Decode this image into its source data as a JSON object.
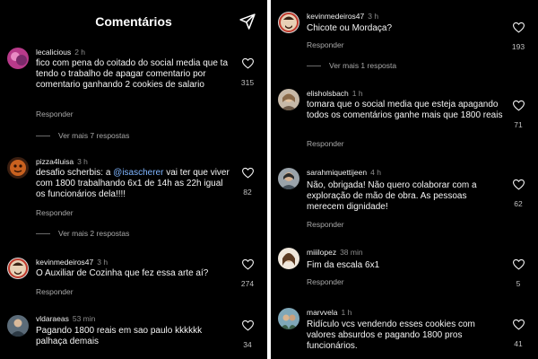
{
  "left": {
    "title": "Comentários",
    "comments": [
      {
        "user": "lecalicious",
        "time": "2 h",
        "text": "fico com pena do coitado do social media que ta tendo o trabalho de apagar comentario por comentario ganhando 2 cookies de salario",
        "likes": "315",
        "reply": "Responder",
        "more": "Ver mais 7 respostas"
      },
      {
        "user": "pizza4luisa",
        "time": "3 h",
        "text_before": "desafio scherbis: a ",
        "mention": "@isascherer",
        "text_after": " vai ter que viver com 1800 trabalhando 6x1 de 14h as 22h igual os funcionários dela!!!!",
        "likes": "82",
        "reply": "Responder",
        "more": "Ver mais 2 respostas"
      },
      {
        "user": "kevinmedeiros47",
        "time": "3 h",
        "text": "O Auxiliar de Cozinha que fez essa arte aí?",
        "likes": "274",
        "reply": "Responder"
      },
      {
        "user": "vldaraeas",
        "time": "53 min",
        "text": "Pagando 1800 reais em sao paulo kkkkkk palhaça demais",
        "likes": "34"
      }
    ]
  },
  "right": {
    "comments": [
      {
        "user": "kevinmedeiros47",
        "time": "3 h",
        "text": "Chicote ou Mordaça?",
        "likes": "193",
        "reply": "Responder",
        "more": "Ver mais 1 resposta"
      },
      {
        "user": "elisholsbach",
        "time": "1 h",
        "text": "tomara que o social media que esteja apagando todos os comentários ganhe mais que 1800 reais",
        "likes": "71",
        "reply": "Responder"
      },
      {
        "user": "sarahmiquettijeen",
        "time": "4 h",
        "text": "Não, obrigada! Não quero colaborar com a exploração de mão de obra. As pessoas merecem dignidade!",
        "likes": "62",
        "reply": "Responder"
      },
      {
        "user": "miiilopez",
        "time": "38 min",
        "text": "Fim da escala 6x1",
        "likes": "5",
        "reply": "Responder"
      },
      {
        "user": "marvvela",
        "time": "1 h",
        "text": "Ridículo vcs vendendo esses cookies com valores absurdos e pagando 1800 pros funcionários.",
        "likes": "41"
      }
    ]
  },
  "icons": {
    "send": "send-icon",
    "like": "heart-outline-icon"
  },
  "colors": {
    "background": "#000000",
    "text": "#f5f5f5",
    "muted": "#a8a8a8",
    "mention": "#7fb5ff",
    "separator": "#ffffff"
  }
}
